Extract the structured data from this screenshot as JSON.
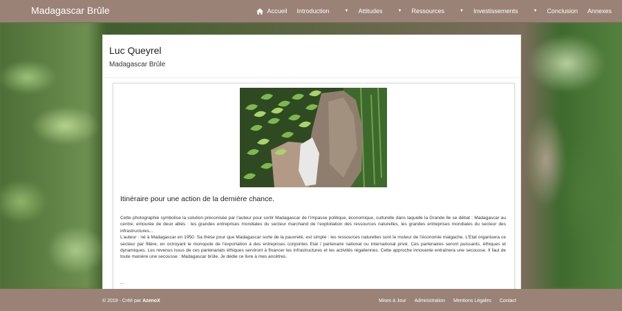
{
  "header": {
    "brand": "Madagascar Brûle",
    "nav": [
      {
        "label": "Accueil",
        "icon": "home-icon"
      },
      {
        "label": "Introduction",
        "dropdown": true
      },
      {
        "label": "Attitudes",
        "dropdown": true
      },
      {
        "label": "Ressources",
        "dropdown": true
      },
      {
        "label": "Investissements",
        "dropdown": true
      },
      {
        "label": "Conclusion"
      },
      {
        "label": "Annexes"
      }
    ]
  },
  "card": {
    "author": "Luc Queyrel",
    "subtitle": "Madagascar Brûle",
    "section_title": "Itinéraire pour une action de la dernière chance.",
    "paragraphs": [
      "Cette photographie symbolise la solution préconisée par l’auteur pour sortir Madagascar de l’impasse politique, économique, culturelle dans laquelle la Grande Ile se débat : Madagascar au centre, entourée de deux alliés : les grandes entreprises mondiales du secteur marchand de l’exploitation des ressources naturelles, les grandes entreprises mondiales du secteur des infrastructures...",
      "L’auteur : né à Madagascar en 1950. Sa thèse pour que Madagascar sorte de la pauvreté, est simple : les ressources naturelles sont le moteur de l’économie malgache. L’Etat organisera ce secteur par filière, en octroyant le monopole de l’exportation à des entreprises conjointes Etat / partenaire national ou international privé. Ces partenaires seront puissants, éthiques et dynamiques. Les revenus issus de ces partenariats éthiques serviront à financer les infrastructures et les activités régaliennes. Cette approche innovante entraînera une secousse. Il faut de toute manière une secousse : Madagascar brûle. Je dédie ce livre à mes ancêtres."
    ],
    "ellipsis": "..."
  },
  "footer": {
    "copyright_prefix": "© 2019 - Créé par ",
    "copyright_author": "AzenoX",
    "links": [
      "Mises à Jour",
      "Administration",
      "Mentions Légales",
      "Contact"
    ]
  }
}
